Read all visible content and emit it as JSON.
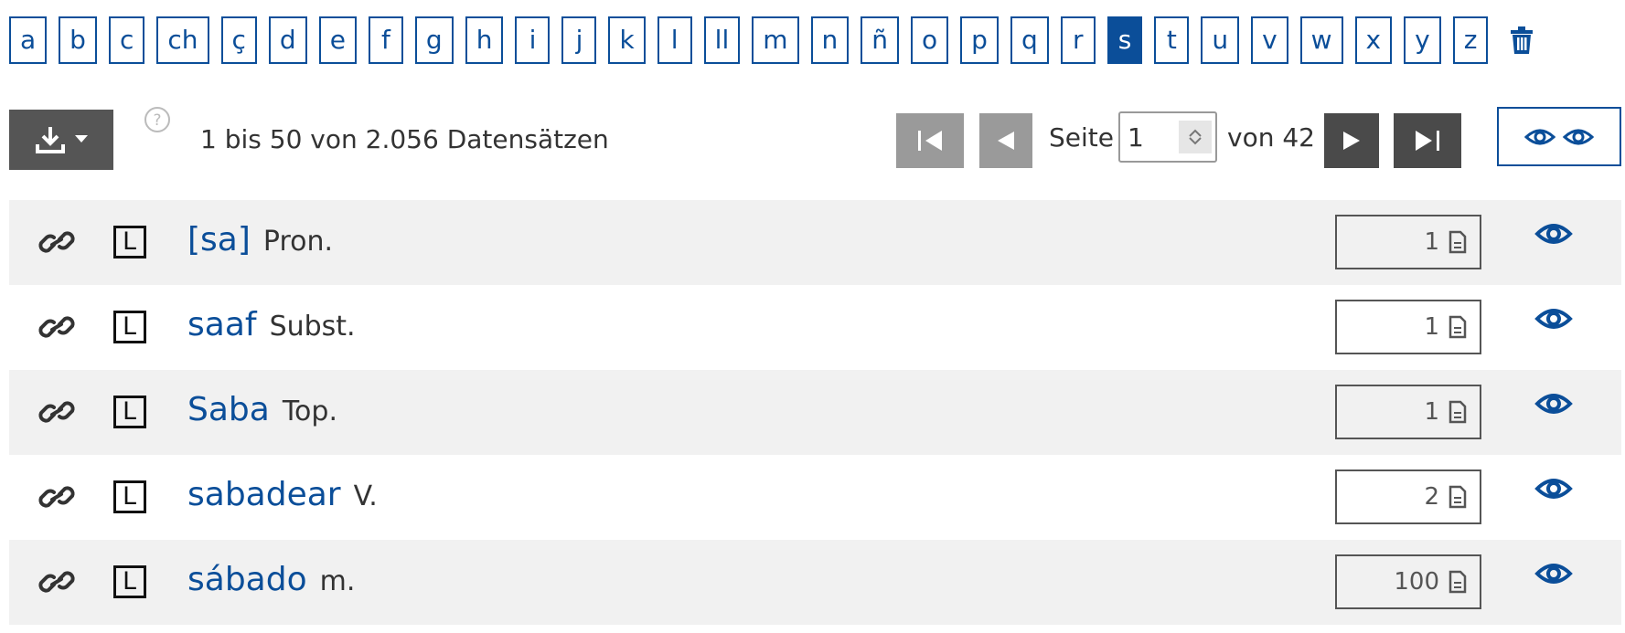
{
  "alphabet": {
    "letters": [
      "a",
      "b",
      "c",
      "ch",
      "ç",
      "d",
      "e",
      "f",
      "g",
      "h",
      "i",
      "j",
      "k",
      "l",
      "ll",
      "m",
      "n",
      "ñ",
      "o",
      "p",
      "q",
      "r",
      "s",
      "t",
      "u",
      "v",
      "w",
      "x",
      "y",
      "z"
    ],
    "active": "s",
    "clear_icon": "trash-icon"
  },
  "toolbar": {
    "download_icon": "download-icon",
    "help_icon": "help-circle-icon",
    "record_count": "1 bis 50 von 2.056 Datensätzen"
  },
  "pagination": {
    "page_label": "Seite",
    "current_page": "1",
    "of_label": "von 42",
    "first_icon": "first-page-icon",
    "prev_icon": "prev-page-icon",
    "next_icon": "next-page-icon",
    "last_icon": "last-page-icon"
  },
  "view_toggle_icon": "double-eye-icon",
  "rows": [
    {
      "lemma": "[sa]",
      "pos": "Pron.",
      "count": "1"
    },
    {
      "lemma": "saaf",
      "pos": "Subst.",
      "count": "1"
    },
    {
      "lemma": "Saba",
      "pos": "Top.",
      "count": "1"
    },
    {
      "lemma": "sabadear",
      "pos": "V.",
      "count": "2"
    },
    {
      "lemma": "sábado",
      "pos": "m.",
      "count": "100"
    }
  ],
  "row_letter_badge": "L",
  "colors": {
    "accent": "#0b4e99",
    "row_shade": "#f1f1f1",
    "dark_button": "#4a4a4a",
    "disabled_button": "#9a9a9a"
  }
}
